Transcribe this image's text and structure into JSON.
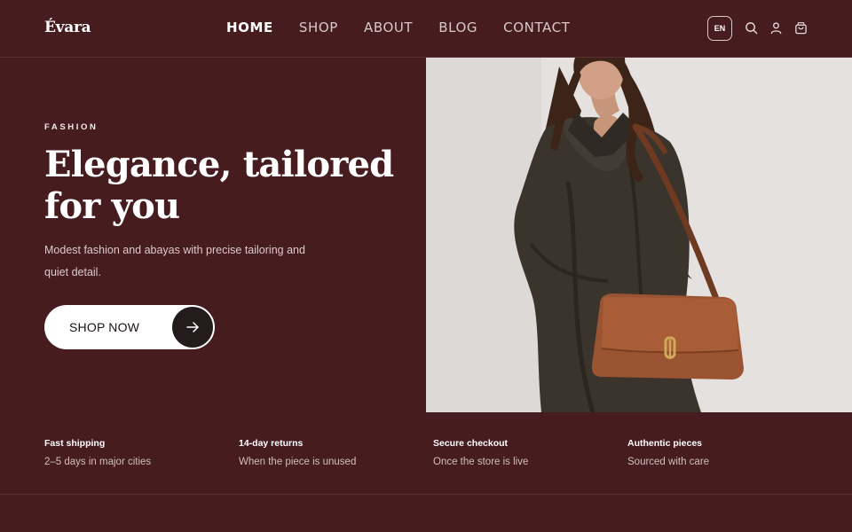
{
  "brand": {
    "logo": "Évara"
  },
  "nav": {
    "items": [
      {
        "label": "HOME",
        "active": true
      },
      {
        "label": "SHOP",
        "active": false
      },
      {
        "label": "ABOUT",
        "active": false
      },
      {
        "label": "BLOG",
        "active": false
      },
      {
        "label": "CONTACT",
        "active": false
      }
    ]
  },
  "header": {
    "language": "EN",
    "icons": [
      "search-icon",
      "user-icon",
      "cart-icon"
    ]
  },
  "hero": {
    "eyebrow": "FASHION",
    "title": "Elegance, tailored for you",
    "subtitle": "Modest fashion and abayas with precise tailoring and quiet detail.",
    "cta": {
      "label": "SHOP NOW",
      "icon": "arrow-right-icon"
    }
  },
  "features": [
    {
      "title": "Fast shipping",
      "text": "2–5 days in major cities"
    },
    {
      "title": "14-day returns",
      "text": "When the piece is unused"
    },
    {
      "title": "Secure checkout",
      "text": "Once the store is live"
    },
    {
      "title": "Authentic pieces",
      "text": "Sourced with care"
    }
  ],
  "colors": {
    "background": "#461c1f",
    "text": "#f4ebe7",
    "button_bg": "#ffffff",
    "button_icon_bg": "#231b1c",
    "bag": "#9b5431"
  }
}
